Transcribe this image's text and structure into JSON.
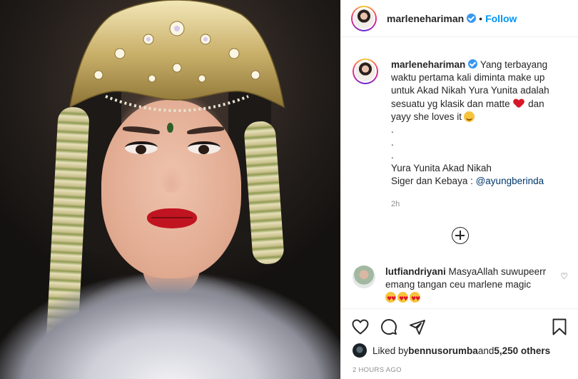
{
  "post": {
    "username": "marlenehariman",
    "follow_label": "Follow",
    "separator": "•",
    "caption_lines": [
      "Yang terbayang waktu pertama kali diminta make up untuk Akad Nikah Yura Yunita adalah sesuatu yg klasik dan matte",
      "dan yayy she loves it"
    ],
    "dots": [
      ".",
      ".",
      "."
    ],
    "caption_line_title": "Yura Yunita Akad Nikah",
    "caption_credit_prefix": "Siger dan Kebaya : ",
    "caption_mention": "@ayungberinda",
    "relative_time": "2h",
    "likes_prefix": "Liked by ",
    "likes_user": "bennusorumba",
    "likes_middle": " and ",
    "likes_count": "5,250 others",
    "timestamp": "2 HOURS AGO"
  },
  "comment": {
    "username": "lutfiandriyani",
    "text": " MasyaAllah suwupeerr emang tangan ceu marlene magic",
    "like_icon": "♡"
  },
  "icons": {
    "like": "heart-icon",
    "comment": "comment-icon",
    "share": "share-icon",
    "save": "bookmark-icon",
    "more": "plus-circle-icon"
  },
  "colors": {
    "accent": "#0095f6",
    "verified": "#3897f0",
    "mention": "#00376b",
    "muted": "#8e8e8e"
  }
}
